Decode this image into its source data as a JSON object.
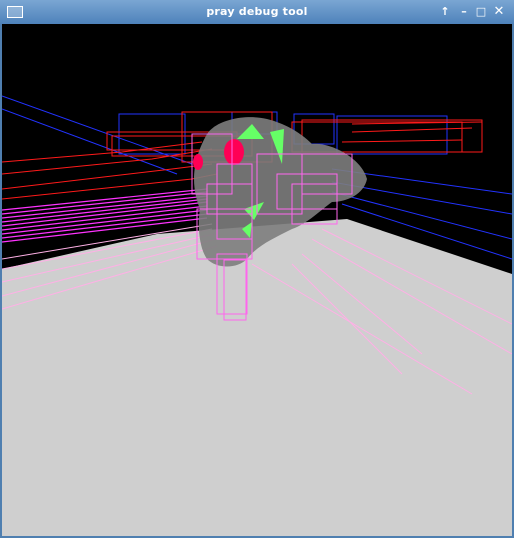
{
  "window": {
    "title": "pray debug tool",
    "buttons": {
      "menu": "window-menu-icon",
      "stick": "up-arrow-icon",
      "minimize": "minimize-icon",
      "maximize": "maximize-icon",
      "close": "close-icon"
    }
  },
  "colors": {
    "titlebar_top": "#7aa6d3",
    "titlebar_bottom": "#4e82bb",
    "sky": "#000000",
    "floor": "#cfcfcf",
    "red_box": "#ff1a1a",
    "blue_box": "#2233ff",
    "magenta_box": "#ff33ff",
    "pink_box": "#ff99dd",
    "model": "#808080"
  }
}
